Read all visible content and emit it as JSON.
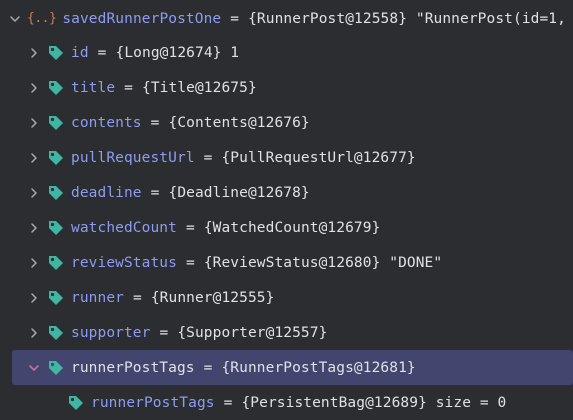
{
  "root": {
    "name": "savedRunnerPostOne",
    "eq": "=",
    "value": "{RunnerPost@12558} \"RunnerPost(id=1,"
  },
  "fields": [
    {
      "name": "id",
      "eq": "=",
      "value": "{Long@12674} 1"
    },
    {
      "name": "title",
      "eq": "=",
      "value": "{Title@12675}"
    },
    {
      "name": "contents",
      "eq": "=",
      "value": "{Contents@12676}"
    },
    {
      "name": "pullRequestUrl",
      "eq": "=",
      "value": "{PullRequestUrl@12677}"
    },
    {
      "name": "deadline",
      "eq": "=",
      "value": "{Deadline@12678}"
    },
    {
      "name": "watchedCount",
      "eq": "=",
      "value": "{WatchedCount@12679}"
    },
    {
      "name": "reviewStatus",
      "eq": "=",
      "value": "{ReviewStatus@12680} \"DONE\""
    },
    {
      "name": "runner",
      "eq": "=",
      "value": "{Runner@12555}"
    },
    {
      "name": "supporter",
      "eq": "=",
      "value": "{Supporter@12557}"
    },
    {
      "name": "runnerPostTags",
      "eq": "=",
      "value": "{RunnerPostTags@12681}"
    }
  ],
  "child": {
    "name": "runnerPostTags",
    "eq": "=",
    "value": "{PersistentBag@12689}  size = 0"
  },
  "colors": {
    "background": "#2b2d30",
    "selection": "#42466e",
    "field_name": "#8e9cf0",
    "text": "#dfe1e5",
    "tag_icon": "#3fb5a2",
    "object_icon": "#c77d5a",
    "chevron": "#a8abb0",
    "chevron_selected": "#d36a9a"
  },
  "icons": {
    "field": "field-tag-icon",
    "object": "object-braces-icon",
    "collapsed": "chevron-right-icon",
    "expanded": "chevron-down-icon"
  }
}
